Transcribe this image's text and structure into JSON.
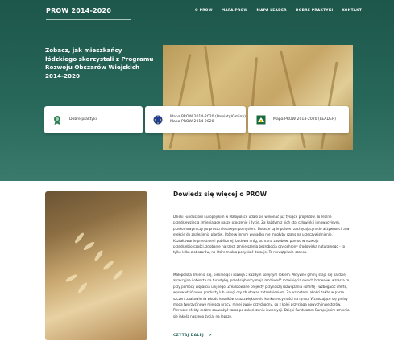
{
  "header": {
    "logo": "PROW 2014-2020",
    "nav": [
      "O PROW",
      "MAPA PROW",
      "MAPA LEADER",
      "DOBRE PRAKTYKI",
      "KONTAKT"
    ]
  },
  "hero": {
    "headline": "Zobacz, jak mieszkańcy łódzkiego skorzystali z Programu Rozwoju Obszarów Wiejskich 2014-2020",
    "cards": [
      {
        "line1": "Dobre praktyki",
        "line2": "",
        "icon": "award-badge-icon"
      },
      {
        "line1": "Mapa PROW 2014-2020 (Powiaty/Gminy)",
        "line2": "Mapa PROW 2014-2020",
        "icon": "eu-flag-logo-icon"
      },
      {
        "line1": "Mapa PROW 2014-2020 (LEADER)",
        "line2": "",
        "icon": "leader-logo-icon"
      }
    ]
  },
  "about": {
    "title": "Dowiedz się więcej o PROW",
    "paragraph1": "Dzięki Funduszom Europejskim w Małopolsce udało się wykonać już tysiące projektów. To realne przedsięwzięcia zmieniające nasze otoczenie i życie. Za każdym z nich stoi człowiek i innowacyjnym, przełomowym czy po prostu ciekawym pomysłem. Dotacje są impulsem zachęcającym do aktywności, a w efekcie do znalezienia planów, które w innym wypadku nie mogłyby szans na urzeczywistnienie. Kształtowanie przestrzeni publicznej, budowa dróg, ochrana zasobów, pomoc w rozwoju przedsiębiorczości, zdobanie na rzecz zmniejszenia bezrobocia czy ochrony środowiska naturalnego - to tylko kilka z obszarów, na które można pozyskać dotacje. To niewątpliwie szansa.",
    "paragraph2": "Małopolska zmienia się, piękniejąc i rozwija z każdym kolejnym rokiem. Aktywne gminy stają się bardziej atrakcyjne i otwarte na turystykę, przedsiębiorcy mają możliwość rozwinięcia swoich biznesów, wzrasta to przy pomocy wsparcia unijnego. Zrealizowane projekty przynoszą rozwiązania i ofertę - wzbogacić ofertę, wprowadzić nowe produkty lub usługi czy zbudować zatrudnieniem. Za wzrostem jakości także w parze szczeni zaakowienia wkodu kosników oraz zwiększeniu konkurencyjności na rynku. Wzrastające się gminy mogą tworzyć nowe miejsca pracy, mniej swoje przychodny, co z kolei przyciąga nowych inwestorów. Pierwsze efekty możne zauważyć zaraz po zakończeniu inwestycji. Dzięki Funduszom Europejskim zmienia się jakość naszego życia, na lepsze.",
    "more_label": "CZYTAJ DALEJ",
    "more_arrow": ">"
  },
  "colors": {
    "hero_bg": "#1d564a",
    "accent": "#2a6b5e"
  }
}
